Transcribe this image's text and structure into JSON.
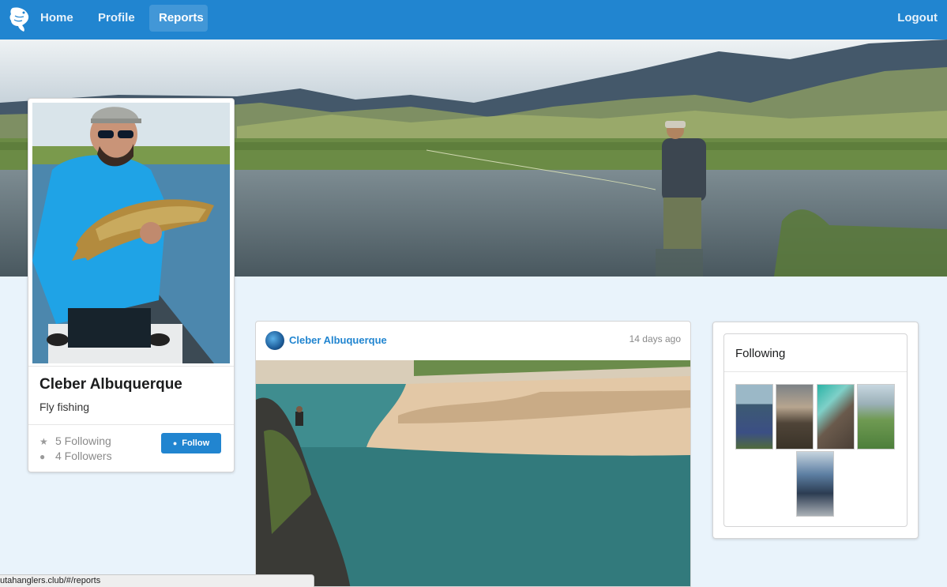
{
  "nav": {
    "items": [
      {
        "label": "Home"
      },
      {
        "label": "Profile"
      },
      {
        "label": "Reports"
      }
    ],
    "logout_label": "Logout",
    "logo_icon": "trout-logo-icon",
    "accent_color": "#2185d0"
  },
  "profile": {
    "name": "Cleber Albuquerque",
    "bio": "Fly fishing",
    "following": "5 Following",
    "followers": "4 Followers",
    "follow_label": "Follow",
    "following_icon": "star-icon",
    "followers_icon": "user-icon"
  },
  "post": {
    "author": "Cleber Albuquerque",
    "time": "14 days ago"
  },
  "following_panel": {
    "title": "Following",
    "count": 5
  },
  "status_bar": {
    "url": "utahanglers.club/#/reports"
  }
}
